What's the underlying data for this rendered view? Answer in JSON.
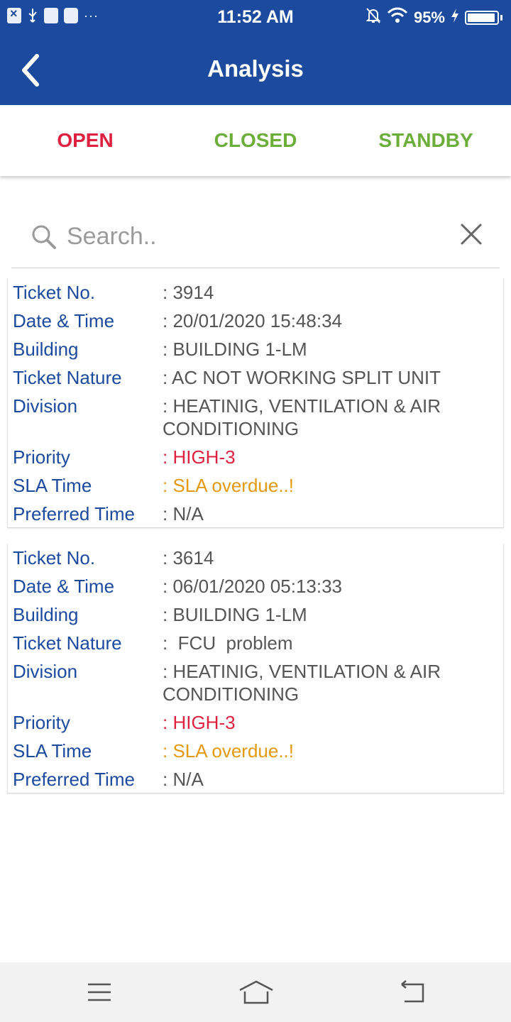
{
  "status_bar": {
    "time": "11:52 AM",
    "battery": "95%",
    "icons": [
      "app-x-icon",
      "usb-icon",
      "usb-debug-icon",
      "mail-icon",
      "more-dots-icon",
      "bell-off-icon",
      "wifi-icon",
      "charging-bolt-icon",
      "battery-icon"
    ],
    "dots": "···"
  },
  "app_bar": {
    "title": "Analysis",
    "back_icon": "chevron-left-icon"
  },
  "tabs": [
    {
      "label": "OPEN",
      "color": "#e0203f"
    },
    {
      "label": "CLOSED",
      "color": "#6cae3a"
    },
    {
      "label": "STANDBY",
      "color": "#6cae3a"
    }
  ],
  "search": {
    "placeholder": "Search..",
    "value": ""
  },
  "tickets": [
    {
      "ticket_no_label": "Ticket No.",
      "ticket_no": ": 3914",
      "datetime_label": "Date & Time",
      "datetime": ": 20/01/2020 15:48:34",
      "building_label": "Building",
      "building": ": BUILDING 1-LM",
      "nature_label": "Ticket Nature",
      "nature": ": AC NOT WORKING SPLIT UNIT",
      "division_label": "Division",
      "division": ": HEATINIG, VENTILATION & AIR CONDITIONING",
      "priority_label": "Priority",
      "priority": ": HIGH-3",
      "sla_label": "SLA Time",
      "sla": ": SLA overdue..!",
      "preferred_label": "Preferred Time",
      "preferred": ": N/A"
    },
    {
      "ticket_no_label": "Ticket No.",
      "ticket_no": ": 3614",
      "datetime_label": "Date & Time",
      "datetime": ": 06/01/2020 05:13:33",
      "building_label": "Building",
      "building": ": BUILDING 1-LM",
      "nature_label": "Ticket Nature",
      "nature": ":  FCU  problem",
      "division_label": "Division",
      "division": ": HEATINIG, VENTILATION & AIR CONDITIONING",
      "priority_label": "Priority",
      "priority": ": HIGH-3",
      "sla_label": "SLA Time",
      "sla": ": SLA overdue..!",
      "preferred_label": "Preferred Time",
      "preferred": ": N/A"
    }
  ],
  "colors": {
    "primary": "#1c4a9e",
    "priority_high": "#e0203f",
    "sla_overdue": "#e39a0f",
    "label": "#1c4a9e"
  },
  "nav_bar": {
    "icons": [
      "menu-icon",
      "home-icon",
      "back-icon"
    ]
  }
}
